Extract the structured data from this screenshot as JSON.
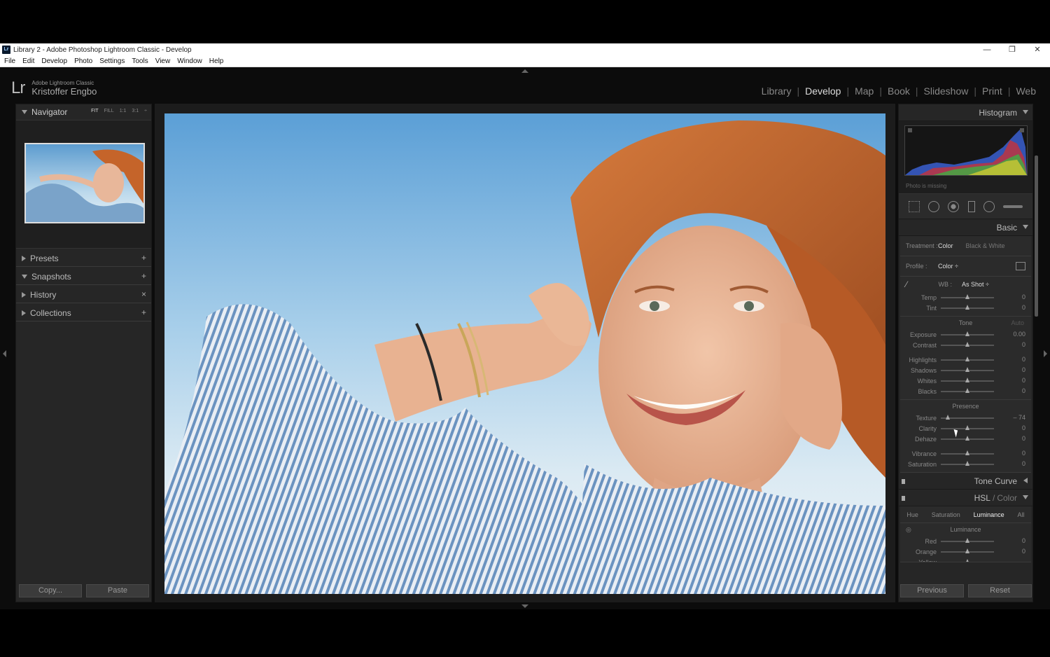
{
  "window": {
    "title": "Library 2 - Adobe Photoshop Lightroom Classic - Develop",
    "app_icon": "Lr"
  },
  "menu": [
    "File",
    "Edit",
    "Develop",
    "Photo",
    "Settings",
    "Tools",
    "View",
    "Window",
    "Help"
  ],
  "identity": {
    "logo": "Lr",
    "app_name": "Adobe Lightroom Classic",
    "user": "Kristoffer Engbo"
  },
  "modules": [
    "Library",
    "Develop",
    "Map",
    "Book",
    "Slideshow",
    "Print",
    "Web"
  ],
  "active_module": "Develop",
  "left": {
    "navigator": {
      "title": "Navigator",
      "zoom": [
        "FIT",
        "FILL",
        "1:1",
        "3:1"
      ]
    },
    "sections": [
      {
        "label": "Presets",
        "action": "+"
      },
      {
        "label": "Snapshots",
        "action": "+"
      },
      {
        "label": "History",
        "action": "×"
      },
      {
        "label": "Collections",
        "action": "+"
      }
    ],
    "copy_label": "Copy...",
    "paste_label": "Paste"
  },
  "right": {
    "histogram_title": "Histogram",
    "photo_missing": "Photo is missing",
    "basic_title": "Basic",
    "treatment": {
      "label": "Treatment :",
      "color": "Color",
      "bw": "Black & White"
    },
    "profile": {
      "label": "Profile :",
      "value": "Color ÷"
    },
    "wb": {
      "label": "WB :",
      "value": "As Shot ÷"
    },
    "wb_sliders": [
      {
        "label": "Temp",
        "value": "0",
        "pos": 0.5
      },
      {
        "label": "Tint",
        "value": "0",
        "pos": 0.5
      }
    ],
    "tone_title": "Tone",
    "tone_auto": "Auto",
    "tone_sliders": [
      {
        "label": "Exposure",
        "value": "0.00",
        "pos": 0.5
      },
      {
        "label": "Contrast",
        "value": "0",
        "pos": 0.5
      }
    ],
    "tone_sliders2": [
      {
        "label": "Highlights",
        "value": "0",
        "pos": 0.5
      },
      {
        "label": "Shadows",
        "value": "0",
        "pos": 0.5
      },
      {
        "label": "Whites",
        "value": "0",
        "pos": 0.5
      },
      {
        "label": "Blacks",
        "value": "0",
        "pos": 0.5
      }
    ],
    "presence_title": "Presence",
    "presence_sliders": [
      {
        "label": "Texture",
        "value": "– 74",
        "pos": 0.13
      },
      {
        "label": "Clarity",
        "value": "0",
        "pos": 0.5
      },
      {
        "label": "Dehaze",
        "value": "0",
        "pos": 0.5
      }
    ],
    "presence_sliders2": [
      {
        "label": "Vibrance",
        "value": "0",
        "pos": 0.5
      },
      {
        "label": "Saturation",
        "value": "0",
        "pos": 0.5
      }
    ],
    "tone_curve_title": "Tone Curve",
    "hsl_title": "HSL",
    "hsl_title2": "Color",
    "hsl_tabs": [
      "Hue",
      "Saturation",
      "Luminance",
      "All"
    ],
    "hsl_active": "Luminance",
    "luminance_title": "Luminance",
    "lum_sliders": [
      {
        "label": "Red",
        "value": "0",
        "pos": 0.5
      },
      {
        "label": "Orange",
        "value": "0",
        "pos": 0.5
      },
      {
        "label": "Yellow",
        "value": "",
        "pos": 0.5
      }
    ],
    "previous_label": "Previous",
    "reset_label": "Reset"
  }
}
